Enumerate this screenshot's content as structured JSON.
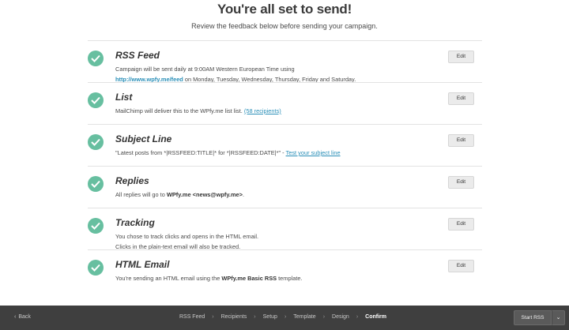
{
  "header": {
    "title": "You're all set to send!",
    "subtitle": "Review the feedback below before sending your campaign."
  },
  "checklist": [
    {
      "title": "RSS Feed",
      "line1": "Campaign will be sent daily at 9:00AM Western European Time using",
      "feed_url": "http://www.wpfy.me/feed",
      "line2_suffix": " on Monday, Tuesday, Wednesday, Thursday, Friday and Saturday.",
      "edit_label": "Edit"
    },
    {
      "title": "List",
      "prefix": "MailChimp will deliver this to the WPfy.me list list. ",
      "recipients_link": "(58 recipients)",
      "edit_label": "Edit"
    },
    {
      "title": "Subject Line",
      "subject": "\"Latest posts from *|RSSFEED:TITLE|* for *|RSSFEED:DATE|*\" - ",
      "test_link": "Test your subject line",
      "edit_label": "Edit"
    },
    {
      "title": "Replies",
      "prefix": "All replies will go to ",
      "reply_to": "WPfy.me <news@wpfy.me>",
      "suffix": ".",
      "edit_label": "Edit"
    },
    {
      "title": "Tracking",
      "line1": "You chose to track clicks and opens in the HTML email.",
      "line2": "Clicks in the plain-text email will also be tracked.",
      "edit_label": "Edit"
    },
    {
      "title": "HTML Email",
      "prefix": "You're sending an HTML email using the ",
      "template": "WPfy.me Basic RSS",
      "suffix": " template.",
      "edit_label": "Edit"
    }
  ],
  "footer": {
    "back_label": "Back",
    "steps": [
      "RSS Feed",
      "Recipients",
      "Setup",
      "Template",
      "Design",
      "Confirm"
    ],
    "active_step": "Confirm",
    "start_label": "Start RSS"
  },
  "colors": {
    "check": "#67bfa0",
    "link": "#2a8fb8",
    "footer_bg": "#3f3f3f"
  }
}
